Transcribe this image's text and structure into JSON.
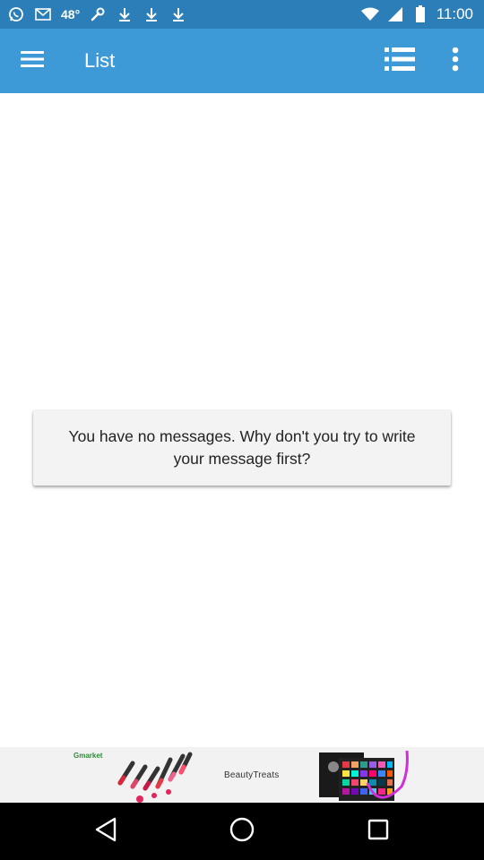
{
  "status_bar": {
    "temperature": "48°",
    "time": "11:00",
    "icons": [
      "whatsapp-icon",
      "email-icon",
      "temperature-icon",
      "wrench-icon",
      "download-icon",
      "download-icon",
      "download-icon",
      "wifi-icon",
      "signal-icon",
      "battery-icon"
    ]
  },
  "app_bar": {
    "title": "List",
    "menu_icon": "hamburger-menu-icon",
    "list_icon": "list-view-icon",
    "overflow_icon": "more-vertical-icon"
  },
  "content": {
    "empty_message": "You have no messages. Why don't you try to write your message first?"
  },
  "ad_banner": {
    "brand": "Gmarket",
    "logo_text": "BeautyTreats"
  },
  "navigation": {
    "back_icon": "back-triangle-icon",
    "home_icon": "home-circle-icon",
    "recents_icon": "recents-square-icon"
  },
  "colors": {
    "status_bar": "#2b7eb8",
    "app_bar": "#3d9ad6",
    "card": "#f3f3f3",
    "nav_bar": "#000000"
  }
}
